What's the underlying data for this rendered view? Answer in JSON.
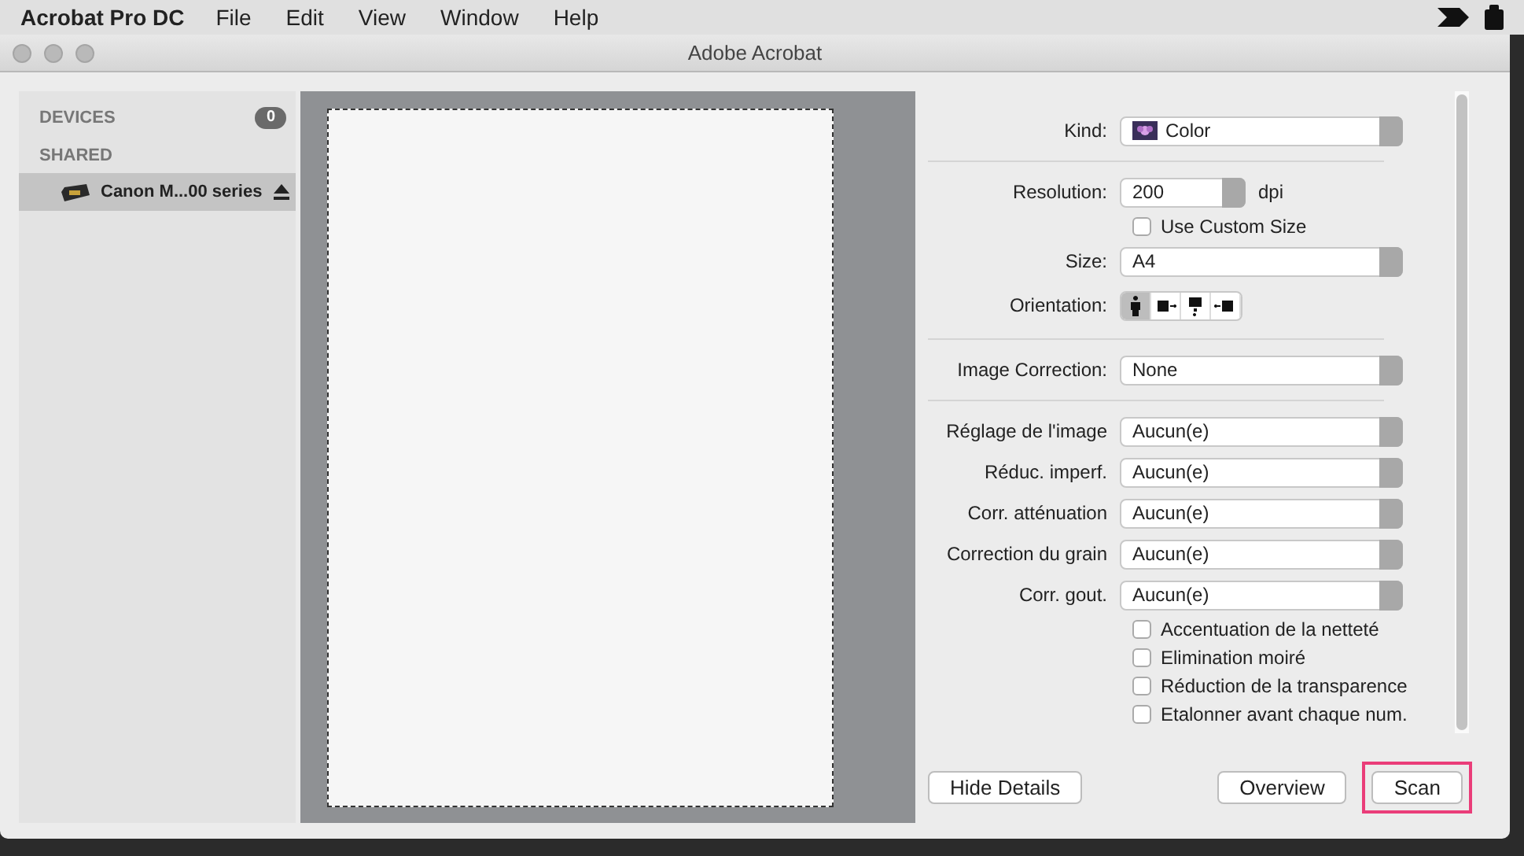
{
  "menubar": {
    "app_name": "Acrobat Pro DC",
    "items": [
      "File",
      "Edit",
      "View",
      "Window",
      "Help"
    ]
  },
  "window": {
    "title": "Adobe Acrobat"
  },
  "sidebar": {
    "sections": [
      {
        "heading": "DEVICES",
        "count": "0"
      },
      {
        "heading": "SHARED",
        "items": [
          {
            "label": "Canon M...00 series",
            "selected": true
          }
        ]
      }
    ]
  },
  "settings": [
    {
      "kind": "select",
      "label": "Kind:",
      "value": "Color",
      "swatch": true
    },
    {
      "kind": "divider"
    },
    {
      "kind": "combo",
      "label": "Resolution:",
      "value": "200",
      "unit": "dpi"
    },
    {
      "kind": "checkbox",
      "label": "Use Custom Size",
      "checked": false
    },
    {
      "kind": "select",
      "label": "Size:",
      "value": "A4"
    },
    {
      "kind": "segmented",
      "label": "Orientation:",
      "options": [
        {
          "selected": true
        },
        {
          "selected": false
        },
        {
          "selected": false
        },
        {
          "selected": false
        }
      ]
    },
    {
      "kind": "divider"
    },
    {
      "kind": "select",
      "label": "Image Correction:",
      "value": "None"
    },
    {
      "kind": "divider"
    },
    {
      "kind": "select",
      "label": "Réglage de l'image",
      "value": "Aucun(e)"
    },
    {
      "kind": "select",
      "label": "Réduc. imperf.",
      "value": "Aucun(e)"
    },
    {
      "kind": "select",
      "label": "Corr. atténuation",
      "value": "Aucun(e)"
    },
    {
      "kind": "select",
      "label": "Correction du grain",
      "value": "Aucun(e)"
    },
    {
      "kind": "select",
      "label": "Corr. gout.",
      "value": "Aucun(e)"
    },
    {
      "kind": "checkbox",
      "label": "Accentuation de la netteté",
      "checked": false
    },
    {
      "kind": "checkbox",
      "label": "Elimination moiré",
      "checked": false
    },
    {
      "kind": "checkbox",
      "label": "Réduction de la transparence",
      "checked": false
    },
    {
      "kind": "checkbox",
      "label": "Etalonner avant chaque num.",
      "checked": false
    }
  ],
  "buttons": [
    {
      "label": "Hide Details",
      "highlighted": false
    },
    {
      "label": "Overview",
      "highlighted": false
    },
    {
      "label": "Scan",
      "highlighted": true
    }
  ]
}
